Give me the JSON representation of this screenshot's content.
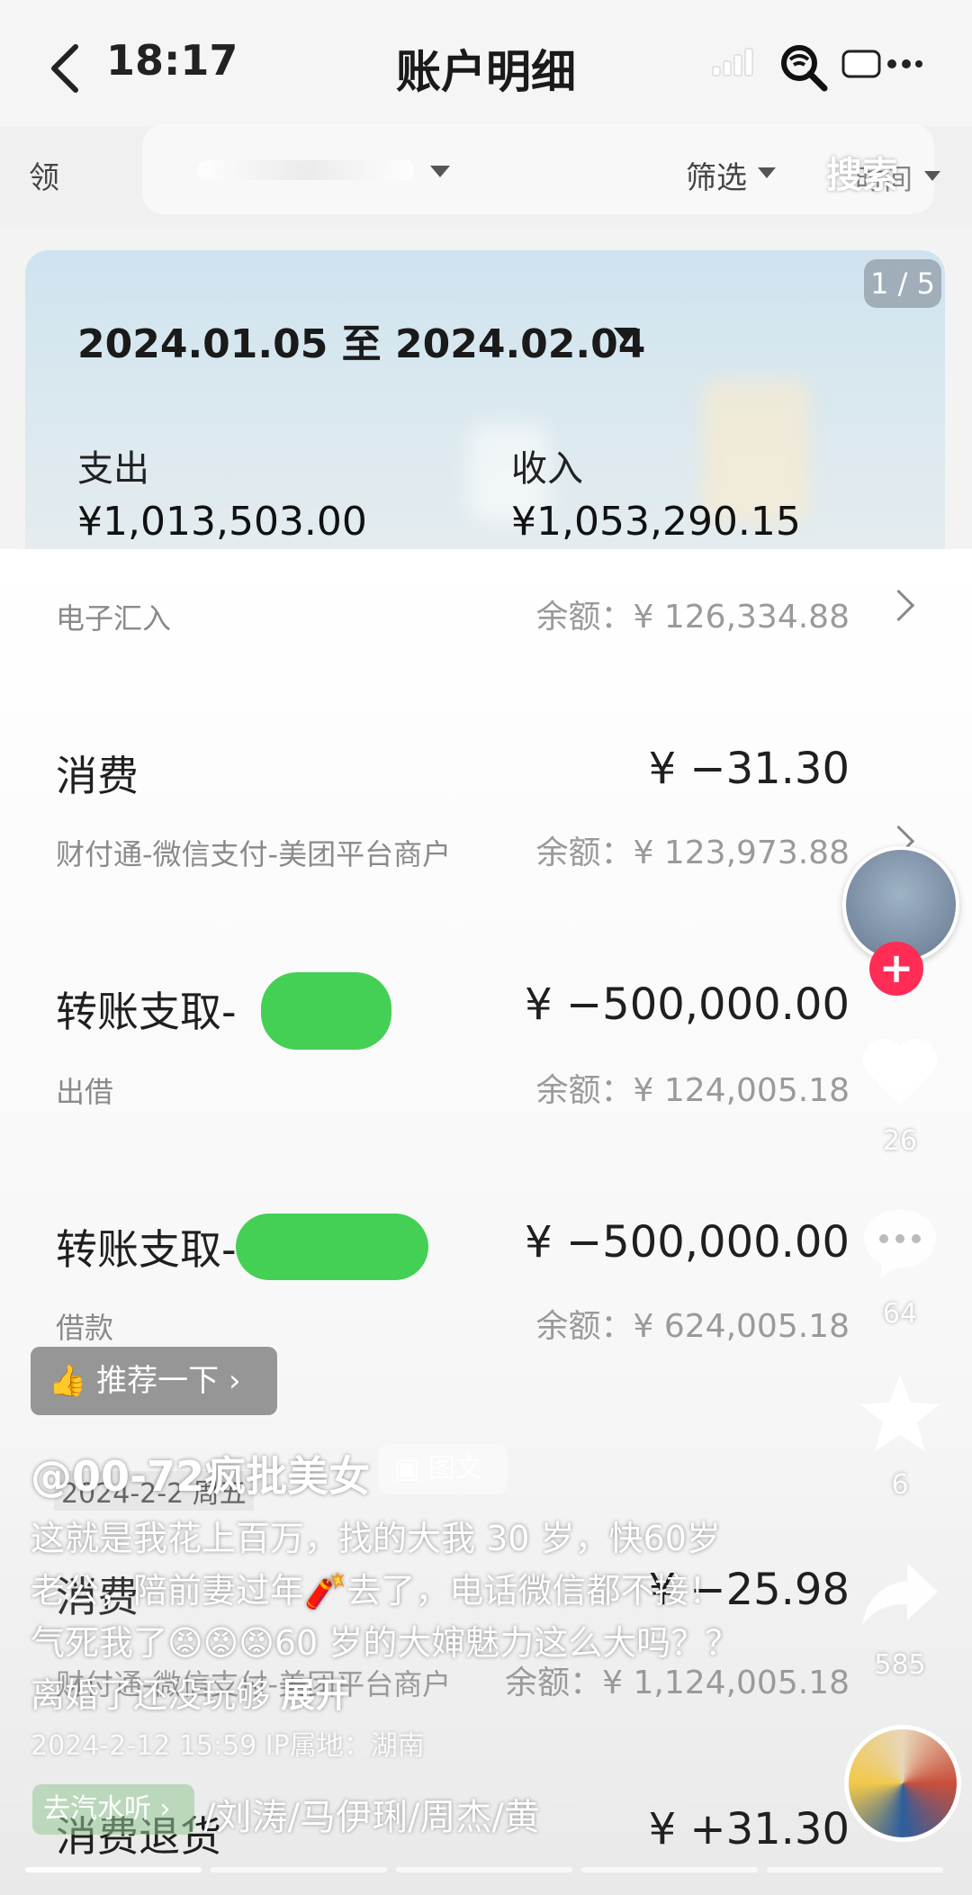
{
  "status": {
    "time": "18:17"
  },
  "header": {
    "title": "账户明细"
  },
  "filter": {
    "left_text": "领",
    "filter_label": "筛选",
    "search_label": "搜索",
    "time_label": "时间"
  },
  "summary": {
    "page_indicator": "1 / 5",
    "date_range": "2024.01.05 至 2024.02.04",
    "expense_label": "支出",
    "expense_value": "¥1,013,503.00",
    "income_label": "收入",
    "income_value": "¥1,053,290.15"
  },
  "transactions": [
    {
      "title": "",
      "amount": "",
      "subtitle": "电子汇入",
      "balance": "余额：¥ 126,334.88"
    },
    {
      "title": "消费",
      "amount": "¥ −31.30",
      "subtitle": "财付通-微信支付-美团平台商户",
      "balance": "余额：¥ 123,973.88"
    },
    {
      "title": "转账支取-",
      "amount": "¥ −500,000.00",
      "subtitle": "出借",
      "balance": "余额：¥ 124,005.18"
    },
    {
      "title": "转账支取-",
      "amount": "¥ −500,000.00",
      "subtitle": "借款",
      "balance": "余额：¥ 624,005.18"
    },
    {
      "title": "消费",
      "amount": "¥ −25.98",
      "subtitle": "财付通-微信支付-美团平台商户",
      "balance": "余额：¥ 1,124,005.18"
    },
    {
      "title": "消费退货",
      "amount": "¥ +31.30",
      "subtitle": "",
      "balance": ""
    }
  ],
  "list_date_header": "2024-2-2 周五",
  "overlay": {
    "likes": "26",
    "comments": "64",
    "favorites": "6",
    "shares": "585",
    "recommend_label": "推荐一下",
    "author": "@00-72疯批美女",
    "tag": "图文",
    "caption": "这就是我花上百万，找的大我 30 岁，快60岁老公，陪前妻过年🧨去了，电话微信都不接！气死我了😡😡😡60 岁的大婶魅力这么大吗？？离婚了还没玩够",
    "expand_label": "展开",
    "post_meta": "2024-2-12 15:59  IP属地：湖南",
    "music_chip": "去汽水听 ›",
    "music_title": "/刘涛/马伊琍/周杰/黄"
  },
  "colors": {
    "redact_green": "#43d054",
    "plus_red": "#ff2d55"
  }
}
